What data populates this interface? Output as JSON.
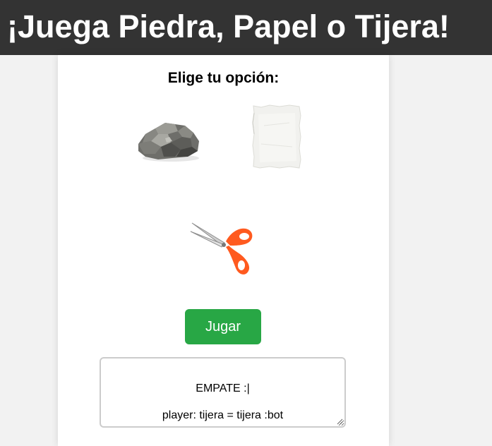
{
  "header": {
    "title": "¡Juega Piedra, Papel o Tijera!"
  },
  "game": {
    "prompt": "Elige tu opción:",
    "choices": [
      {
        "id": "piedra",
        "icon": "rock-icon"
      },
      {
        "id": "papel",
        "icon": "paper-icon"
      },
      {
        "id": "tijera",
        "icon": "scissors-icon"
      }
    ],
    "play_label": "Jugar",
    "result_line1": "EMPATE :|",
    "result_line2": "player: tijera = tijera :bot"
  },
  "colors": {
    "header_bg": "#333333",
    "play_button": "#28a745",
    "scissors_handle": "#ff5a1f"
  }
}
